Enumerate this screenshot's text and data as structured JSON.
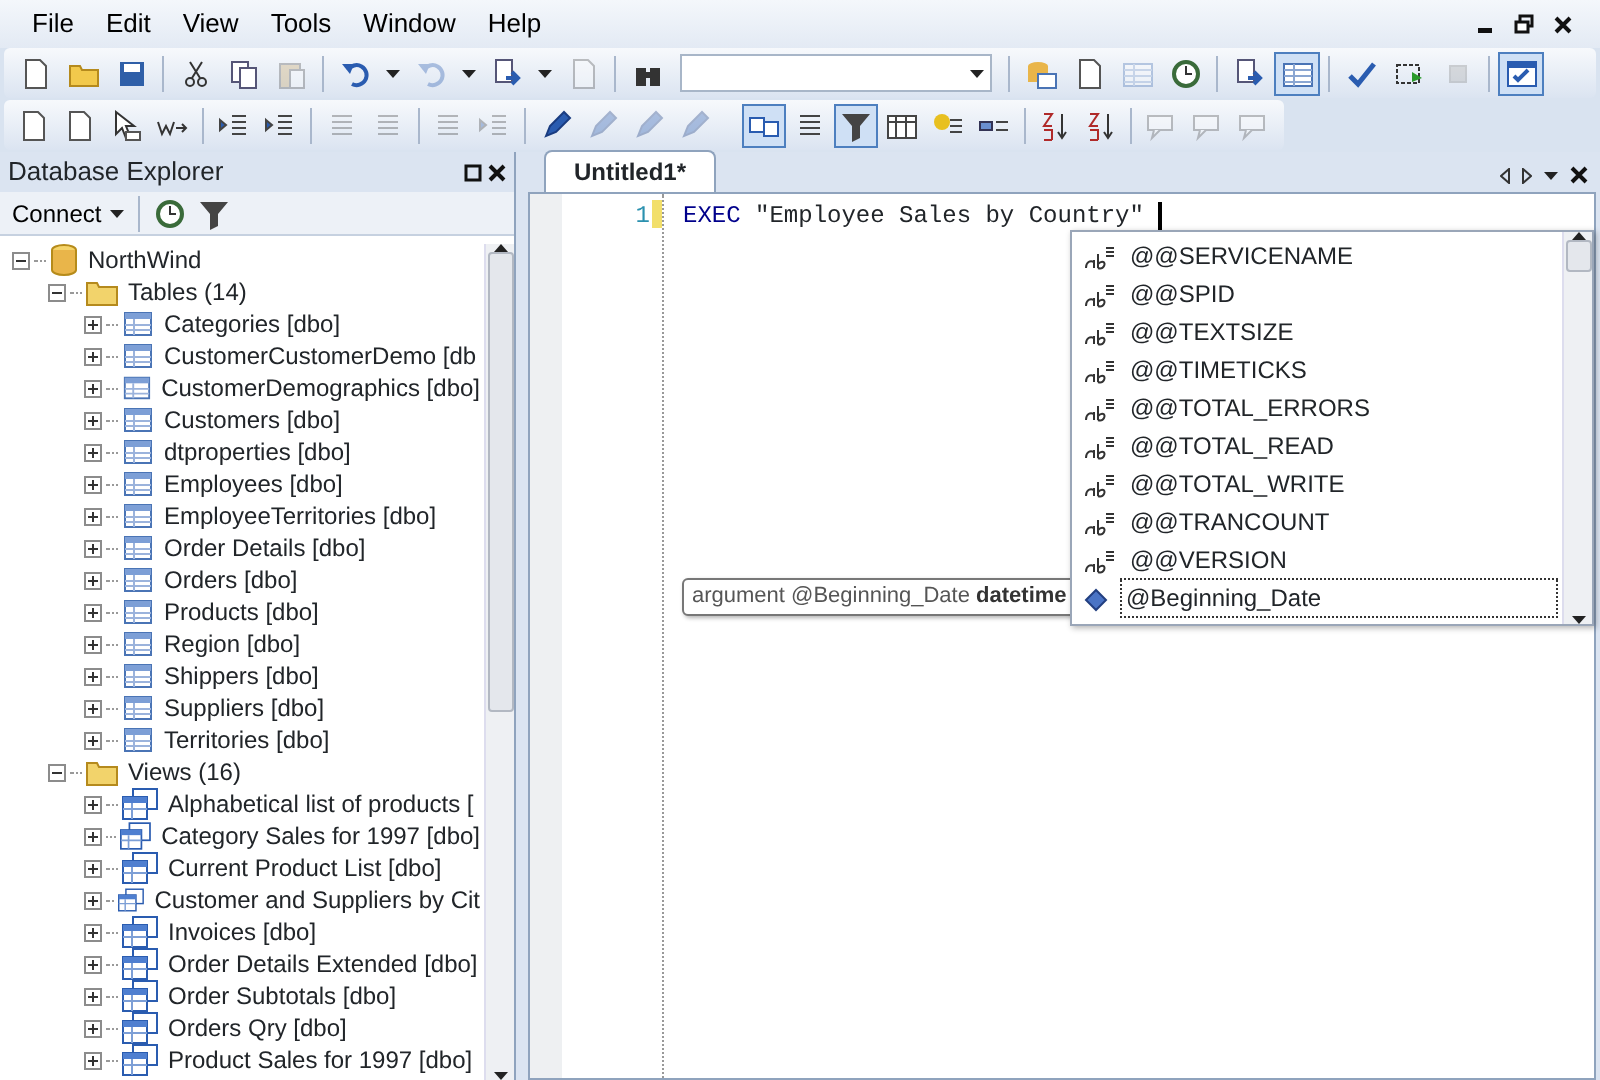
{
  "menu": [
    {
      "label": "File"
    },
    {
      "label": "Edit"
    },
    {
      "label": "View"
    },
    {
      "label": "Tools"
    },
    {
      "label": "Window"
    },
    {
      "label": "Help"
    }
  ],
  "toolbars": [
    [
      {
        "kind": "button",
        "pressed": false,
        "disabled": false
      },
      {
        "kind": "button",
        "pressed": false,
        "disabled": false
      },
      {
        "kind": "button",
        "pressed": false,
        "disabled": false
      },
      {
        "kind": "separator"
      },
      {
        "kind": "button",
        "pressed": false,
        "disabled": false
      },
      {
        "kind": "button",
        "pressed": false,
        "disabled": false
      },
      {
        "kind": "button",
        "pressed": false,
        "disabled": true
      },
      {
        "kind": "separator"
      },
      {
        "kind": "button",
        "pressed": false,
        "disabled": false
      },
      {
        "kind": "dropdown"
      },
      {
        "kind": "button",
        "pressed": false,
        "disabled": true
      },
      {
        "kind": "dropdown"
      },
      {
        "kind": "button",
        "pressed": false,
        "disabled": false
      },
      {
        "kind": "dropdown"
      },
      {
        "kind": "button",
        "pressed": false,
        "disabled": true
      },
      {
        "kind": "separator"
      },
      {
        "kind": "button",
        "pressed": false,
        "disabled": false
      },
      {
        "kind": "combo"
      },
      {
        "kind": "separator"
      },
      {
        "kind": "button",
        "pressed": false,
        "disabled": false
      },
      {
        "kind": "button",
        "pressed": false,
        "disabled": false
      },
      {
        "kind": "button",
        "pressed": false,
        "disabled": true
      },
      {
        "kind": "button",
        "pressed": false,
        "disabled": false
      },
      {
        "kind": "separator"
      },
      {
        "kind": "button",
        "pressed": false,
        "disabled": false
      },
      {
        "kind": "button",
        "pressed": true,
        "disabled": false
      },
      {
        "kind": "separator"
      },
      {
        "kind": "button",
        "pressed": false,
        "disabled": false
      },
      {
        "kind": "button",
        "pressed": false,
        "disabled": false
      },
      {
        "kind": "button",
        "pressed": false,
        "disabled": true
      },
      {
        "kind": "separator"
      },
      {
        "kind": "button",
        "pressed": true,
        "disabled": false
      }
    ],
    [
      {
        "kind": "button",
        "pressed": false,
        "disabled": false
      },
      {
        "kind": "button",
        "pressed": false,
        "disabled": false
      },
      {
        "kind": "button",
        "pressed": false,
        "disabled": false
      },
      {
        "kind": "button",
        "pressed": false,
        "disabled": false
      },
      {
        "kind": "separator"
      },
      {
        "kind": "button",
        "pressed": false,
        "disabled": false
      },
      {
        "kind": "button",
        "pressed": false,
        "disabled": false
      },
      {
        "kind": "separator"
      },
      {
        "kind": "button",
        "pressed": false,
        "disabled": true
      },
      {
        "kind": "button",
        "pressed": false,
        "disabled": true
      },
      {
        "kind": "separator"
      },
      {
        "kind": "button",
        "pressed": false,
        "disabled": true
      },
      {
        "kind": "button",
        "pressed": false,
        "disabled": true
      },
      {
        "kind": "separator"
      },
      {
        "kind": "button",
        "pressed": false,
        "disabled": false
      },
      {
        "kind": "button",
        "pressed": false,
        "disabled": true
      },
      {
        "kind": "button",
        "pressed": false,
        "disabled": true
      },
      {
        "kind": "button",
        "pressed": false,
        "disabled": true
      },
      {
        "kind": "group"
      },
      {
        "kind": "button",
        "pressed": true,
        "disabled": false
      },
      {
        "kind": "button",
        "pressed": false,
        "disabled": false
      },
      {
        "kind": "button",
        "pressed": true,
        "disabled": false
      },
      {
        "kind": "button",
        "pressed": false,
        "disabled": false
      },
      {
        "kind": "button",
        "pressed": false,
        "disabled": false
      },
      {
        "kind": "button",
        "pressed": false,
        "disabled": false
      },
      {
        "kind": "separator"
      },
      {
        "kind": "button",
        "pressed": false,
        "disabled": false
      },
      {
        "kind": "button",
        "pressed": false,
        "disabled": false
      },
      {
        "kind": "separator"
      },
      {
        "kind": "button",
        "pressed": false,
        "disabled": true
      },
      {
        "kind": "button",
        "pressed": false,
        "disabled": true
      },
      {
        "kind": "button",
        "pressed": false,
        "disabled": true
      }
    ]
  ],
  "explorer": {
    "title": "Database Explorer",
    "connect": "Connect"
  },
  "tree": [
    {
      "label": "NorthWind",
      "kind": "database",
      "expanded": true,
      "children": [
        {
          "label": "Tables (14)",
          "kind": "folder",
          "expanded": true,
          "children": [
            {
              "label": "Categories [dbo]",
              "kind": "table",
              "expanded": false
            },
            {
              "label": "CustomerCustomerDemo [db",
              "kind": "table",
              "expanded": false
            },
            {
              "label": "CustomerDemographics [dbo]",
              "kind": "table",
              "expanded": false
            },
            {
              "label": "Customers [dbo]",
              "kind": "table",
              "expanded": false
            },
            {
              "label": "dtproperties [dbo]",
              "kind": "table",
              "expanded": false
            },
            {
              "label": "Employees [dbo]",
              "kind": "table",
              "expanded": false
            },
            {
              "label": "EmployeeTerritories [dbo]",
              "kind": "table",
              "expanded": false
            },
            {
              "label": "Order Details [dbo]",
              "kind": "table",
              "expanded": false
            },
            {
              "label": "Orders [dbo]",
              "kind": "table",
              "expanded": false
            },
            {
              "label": "Products [dbo]",
              "kind": "table",
              "expanded": false
            },
            {
              "label": "Region [dbo]",
              "kind": "table",
              "expanded": false
            },
            {
              "label": "Shippers [dbo]",
              "kind": "table",
              "expanded": false
            },
            {
              "label": "Suppliers [dbo]",
              "kind": "table",
              "expanded": false
            },
            {
              "label": "Territories [dbo]",
              "kind": "table",
              "expanded": false
            }
          ]
        },
        {
          "label": "Views (16)",
          "kind": "folder",
          "expanded": true,
          "children": [
            {
              "label": "Alphabetical list of products [",
              "kind": "view",
              "expanded": false
            },
            {
              "label": "Category Sales for 1997 [dbo]",
              "kind": "view",
              "expanded": false
            },
            {
              "label": "Current Product List [dbo]",
              "kind": "view",
              "expanded": false
            },
            {
              "label": "Customer and Suppliers by Cit",
              "kind": "view",
              "expanded": false
            },
            {
              "label": "Invoices [dbo]",
              "kind": "view",
              "expanded": false
            },
            {
              "label": "Order Details Extended [dbo]",
              "kind": "view",
              "expanded": false
            },
            {
              "label": "Order Subtotals [dbo]",
              "kind": "view",
              "expanded": false
            },
            {
              "label": "Orders Qry [dbo]",
              "kind": "view",
              "expanded": false
            },
            {
              "label": "Product Sales for 1997 [dbo]",
              "kind": "view",
              "expanded": false
            }
          ]
        }
      ]
    }
  ],
  "tabs": [
    {
      "label": "Untitled1*",
      "selected": true
    }
  ],
  "editor": {
    "lines": [
      {
        "number": "1",
        "tokens": [
          {
            "text": "EXEC",
            "kind": "keyword"
          },
          {
            "text": " \"Employee Sales by Country\" ",
            "kind": "string"
          }
        ]
      }
    ]
  },
  "completion": {
    "items": [
      {
        "label": "@@SERVICENAME",
        "kind": "variable",
        "selected": false
      },
      {
        "label": "@@SPID",
        "kind": "variable",
        "selected": false
      },
      {
        "label": "@@TEXTSIZE",
        "kind": "variable",
        "selected": false
      },
      {
        "label": "@@TIMETICKS",
        "kind": "variable",
        "selected": false
      },
      {
        "label": "@@TOTAL_ERRORS",
        "kind": "variable",
        "selected": false
      },
      {
        "label": "@@TOTAL_READ",
        "kind": "variable",
        "selected": false
      },
      {
        "label": "@@TOTAL_WRITE",
        "kind": "variable",
        "selected": false
      },
      {
        "label": "@@TRANCOUNT",
        "kind": "variable",
        "selected": false
      },
      {
        "label": "@@VERSION",
        "kind": "variable",
        "selected": false
      },
      {
        "label": "@Beginning_Date",
        "kind": "parameter",
        "selected": true
      }
    ]
  },
  "tooltip": "argument @Beginning_Date **datetime**"
}
